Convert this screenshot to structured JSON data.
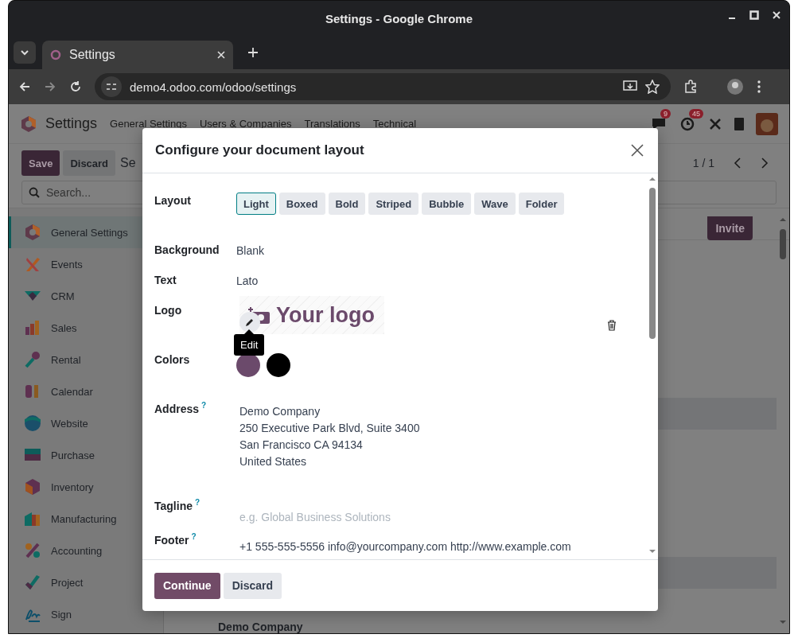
{
  "window": {
    "title": "Settings - Google Chrome"
  },
  "browser": {
    "tab": "Settings",
    "url": "demo4.odoo.com/odoo/settings"
  },
  "navbar": {
    "app": "Settings",
    "menus": [
      "General Settings",
      "Users & Companies",
      "Translations",
      "Technical"
    ],
    "messages_badge": "9",
    "activities_badge": "45"
  },
  "control_panel": {
    "save": "Save",
    "discard": "Discard",
    "breadcrumb": "Se",
    "search": {
      "placeholder": "Search..."
    },
    "pager": "1 / 1"
  },
  "sidebar": {
    "items": [
      {
        "label": "General Settings",
        "selected": true
      },
      {
        "label": "Events",
        "selected": false
      },
      {
        "label": "CRM",
        "selected": false
      },
      {
        "label": "Sales",
        "selected": false
      },
      {
        "label": "Rental",
        "selected": false
      },
      {
        "label": "Calendar",
        "selected": false
      },
      {
        "label": "Website",
        "selected": false
      },
      {
        "label": "Purchase",
        "selected": false
      },
      {
        "label": "Inventory",
        "selected": false
      },
      {
        "label": "Manufacturing",
        "selected": false
      },
      {
        "label": "Accounting",
        "selected": false
      },
      {
        "label": "Project",
        "selected": false
      },
      {
        "label": "Sign",
        "selected": false
      }
    ]
  },
  "content": {
    "invite": "Invite",
    "company": "Demo Company"
  },
  "dialog": {
    "title": "Configure your document layout",
    "layout": {
      "label": "Layout",
      "options": [
        {
          "label": "Light",
          "selected": true
        },
        {
          "label": "Boxed",
          "selected": false
        },
        {
          "label": "Bold",
          "selected": false
        },
        {
          "label": "Striped",
          "selected": false
        },
        {
          "label": "Bubble",
          "selected": false
        },
        {
          "label": "Wave",
          "selected": false
        },
        {
          "label": "Folder",
          "selected": false
        }
      ]
    },
    "background": {
      "label": "Background",
      "value": "Blank"
    },
    "text": {
      "label": "Text",
      "value": "Lato"
    },
    "logo": {
      "label": "Logo",
      "text": "Your logo",
      "tooltip": "Edit"
    },
    "colors": {
      "label": "Colors",
      "swatches": [
        {
          "color": "#6b4a6b"
        },
        {
          "color": "#000000"
        }
      ]
    },
    "address": {
      "label": "Address",
      "help": "?",
      "lines": [
        "Demo Company",
        "250 Executive Park Blvd, Suite 3400",
        "San Francisco CA 94134",
        "United States"
      ]
    },
    "tagline": {
      "label": "Tagline",
      "help": "?",
      "placeholder": "e.g. Global Business Solutions"
    },
    "footer": {
      "label": "Footer",
      "help": "?",
      "value": "+1 555-555-5556 info@yourcompany.com http://www.example.com"
    },
    "buttons": {
      "continue": "Continue",
      "discard": "Discard"
    }
  }
}
